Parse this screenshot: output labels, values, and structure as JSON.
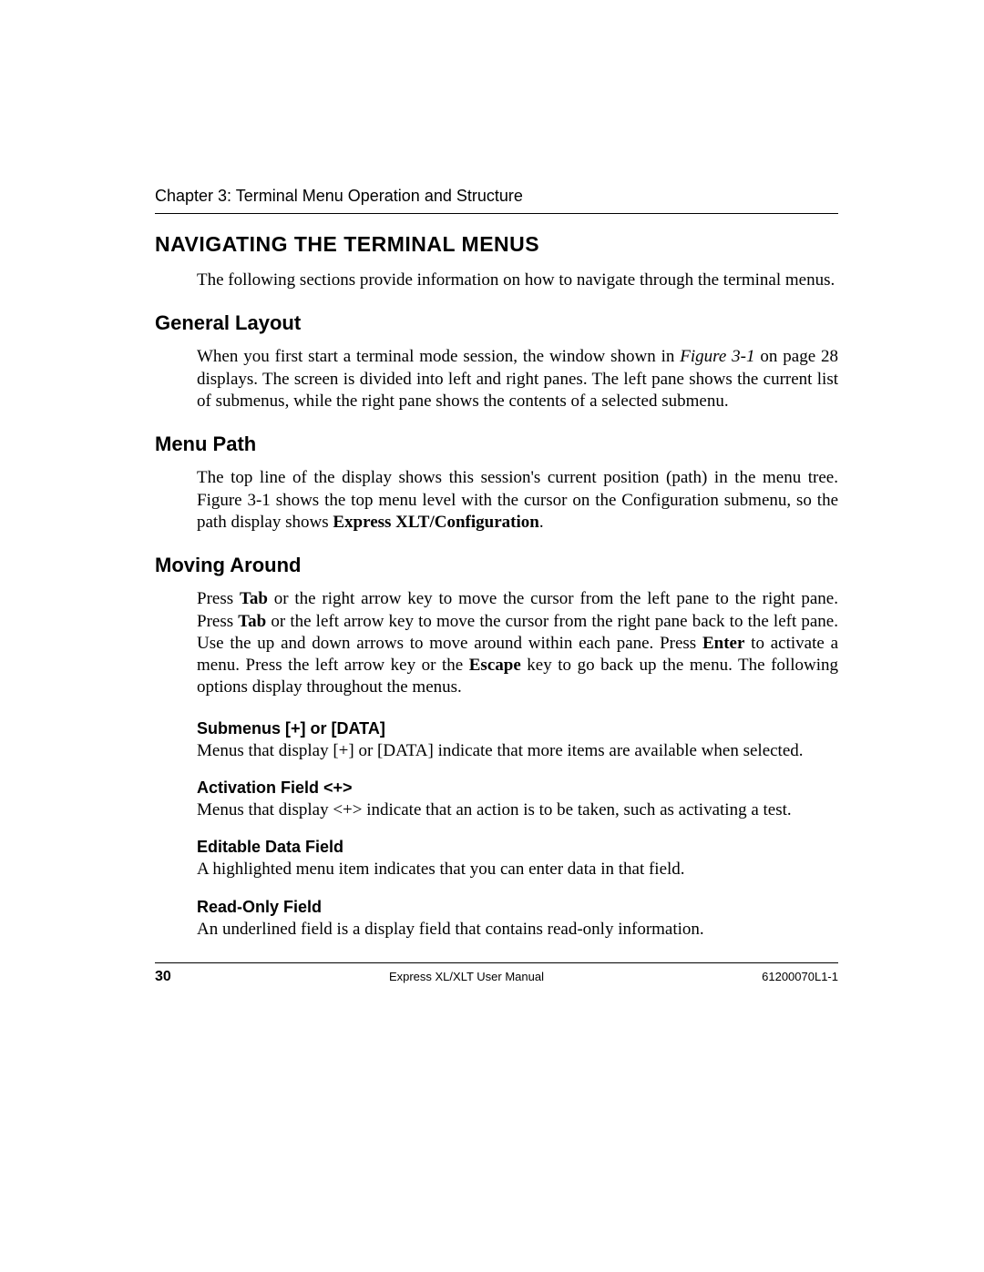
{
  "header": {
    "chapter": "Chapter 3: Terminal Menu Operation and Structure"
  },
  "h1": "NAVIGATING THE TERMINAL MENUS",
  "intro": "The following sections provide information on how to navigate through the terminal menus.",
  "general": {
    "title": "General Layout",
    "p1a": "When you first start a terminal mode session, the window shown in ",
    "p1fig": "Figure 3-1",
    "p1b": " on page 28 displays. The screen is divided into left and right panes.  The left pane shows the current list of submenus, while the right pane shows the contents of a selected submenu."
  },
  "menupath": {
    "title": "Menu Path",
    "p1a": "The top line of the display shows this session's current position (path) in the menu tree.  Figure 3-1 shows the top menu level with the cursor on the Configuration submenu, so the path display shows ",
    "p1bold": "Express XLT/Configuration",
    "p1b": "."
  },
  "moving": {
    "title": "Moving Around",
    "p1a": "Press ",
    "tab1": "Tab",
    "p1b": " or the right arrow key to move the cursor from the left pane to the right pane.  Press ",
    "tab2": "Tab",
    "p1c": " or the left arrow key to move the cursor from the right pane back to the left pane. Use the up and down arrows to move around within each pane. Press ",
    "enter": "Enter",
    "p1d": " to activate a menu. Press the left arrow key or the ",
    "escape": "Escape",
    "p1e": " key to go back up the menu. The following options display throughout the menus.",
    "sub1": {
      "title": "Submenus [+] or [DATA]",
      "body": "Menus that display [+] or [DATA] indicate that more items are available when selected."
    },
    "sub2": {
      "title": "Activation Field <+>",
      "body": "Menus that display <+> indicate that an action is to be taken, such as activating a test."
    },
    "sub3": {
      "title": "Editable Data Field",
      "body": "A highlighted menu item indicates that you can enter data in that field."
    },
    "sub4": {
      "title": "Read-Only Field",
      "body": "An underlined field is a display field that contains read-only information."
    }
  },
  "footer": {
    "page": "30",
    "center": "Express XL/XLT User Manual",
    "code": "61200070L1-1"
  }
}
